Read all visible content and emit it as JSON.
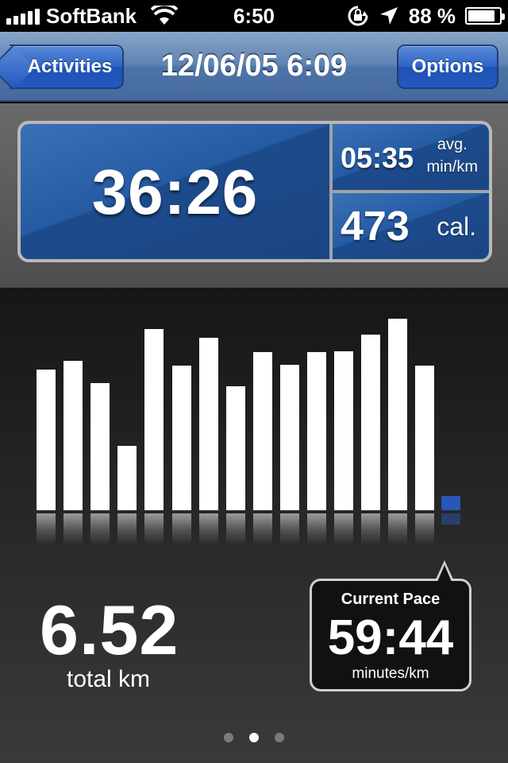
{
  "status_bar": {
    "carrier": "SoftBank",
    "time": "6:50",
    "battery": "88 %",
    "battery_level": 0.88,
    "signal_bars": 5,
    "icons": [
      "signal-icon",
      "wifi-icon",
      "rotation-lock-icon",
      "location-arrow-icon",
      "battery-icon"
    ]
  },
  "navbar": {
    "back_label": "Activities",
    "title": "12/06/05 6:09",
    "options_label": "Options"
  },
  "summary": {
    "duration": "36:26",
    "avg_pace": "05:35",
    "avg_pace_unit_line1": "avg.",
    "avg_pace_unit_line2": "min/km",
    "calories": "473",
    "calories_unit": "cal."
  },
  "chart_data": {
    "type": "bar",
    "values": [
      177,
      188,
      160,
      81,
      228,
      182,
      217,
      156,
      199,
      183,
      199,
      200,
      221,
      241,
      182
    ],
    "current_value": 0,
    "colors": {
      "bar": "#ffffff",
      "current": "#2a56b8"
    }
  },
  "stats": {
    "total_distance": "6.52",
    "total_label": "total km"
  },
  "current_pace": {
    "title": "Current Pace",
    "value": "59:44",
    "unit": "minutes/km"
  },
  "pager": {
    "pages": 3,
    "active": 1
  }
}
